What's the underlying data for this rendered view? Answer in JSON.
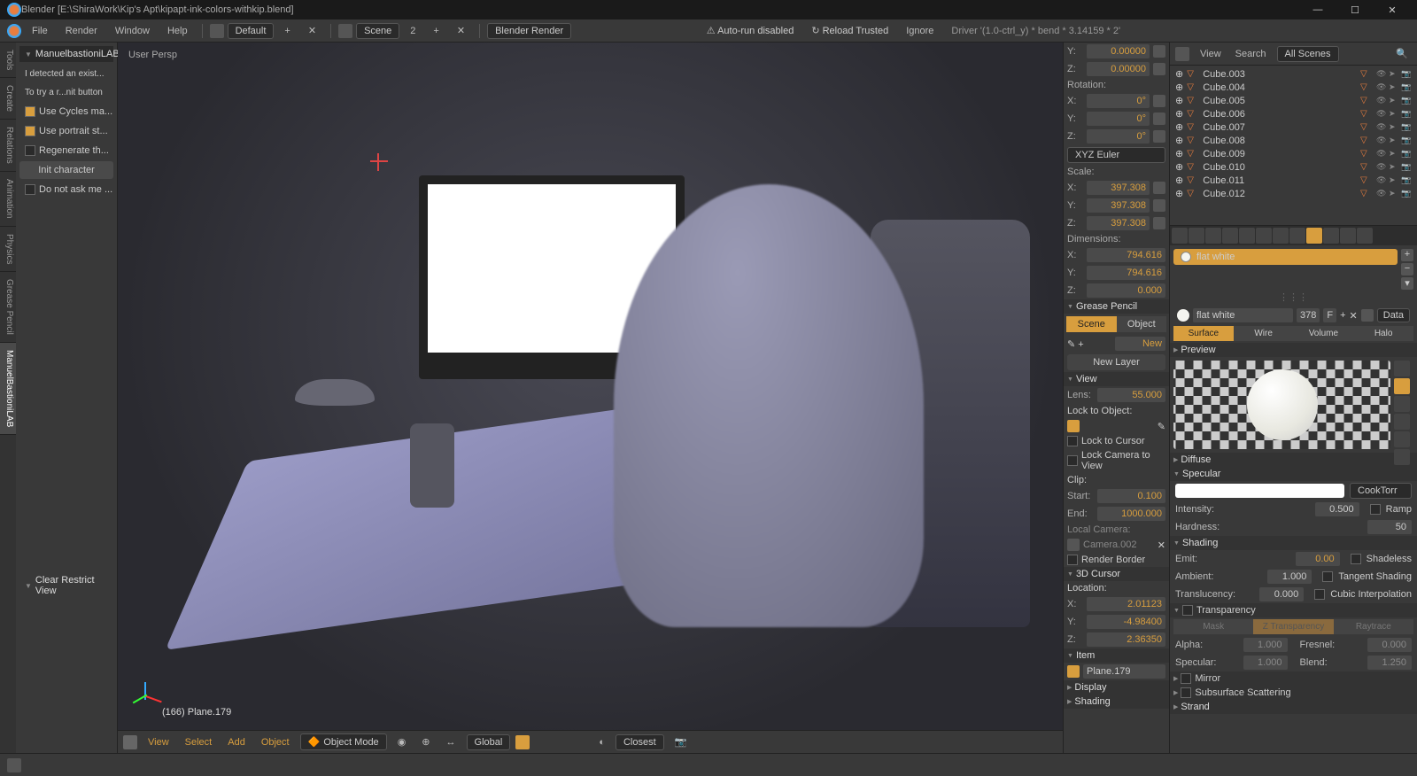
{
  "window": {
    "title": "Blender [E:\\ShiraWork\\Kip's Apt\\kipapt-ink-colors-withkip.blend]",
    "min": "—",
    "max": "☐",
    "close": "✕"
  },
  "topmenu": {
    "file": "File",
    "render": "Render",
    "window": "Window",
    "help": "Help",
    "layout": "Default",
    "plus1": "+",
    "x1": "✕",
    "scene": "Scene",
    "count": "2",
    "plus2": "+",
    "x2": "✕",
    "engine": "Blender Render",
    "autorun": "Auto-run disabled",
    "reload": "Reload Trusted",
    "ignore": "Ignore",
    "driver": "Driver '(1.0-ctrl_y) * bend * 3.14159 * 2'"
  },
  "tooltabs": [
    "Tools",
    "Create",
    "Relations",
    "Animation",
    "Physics",
    "Grease Pencil",
    "ManuelBastioniLAB"
  ],
  "toolpanel": {
    "header": "ManuelbastioniLAB",
    "info1": "I detected an exist...",
    "info2": "To try a r...nit button",
    "chk1": "Use Cycles ma...",
    "chk2": "Use portrait st...",
    "chk3": "Regenerate th...",
    "btn1": "Init character",
    "chk4": "Do not ask me ...",
    "restrict": "Clear Restrict View"
  },
  "viewport": {
    "persp": "User Persp",
    "objinfo": "(166) Plane.179"
  },
  "header3d": {
    "view": "View",
    "select": "Select",
    "add": "Add",
    "object": "Object",
    "mode": "Object Mode",
    "global": "Global",
    "closest": "Closest"
  },
  "npanel": {
    "y1": "Y:",
    "y1v": "0.00000",
    "z1": "Z:",
    "z1v": "0.00000",
    "rotation": "Rotation:",
    "rx": "X:",
    "rxv": "0°",
    "ry": "Y:",
    "ryv": "0°",
    "rz": "Z:",
    "rzv": "0°",
    "euler": "XYZ Euler",
    "scale": "Scale:",
    "sx": "X:",
    "sxv": "397.308",
    "sy": "Y:",
    "syv": "397.308",
    "sz": "Z:",
    "szv": "397.308",
    "dims": "Dimensions:",
    "dx": "X:",
    "dxv": "794.616",
    "dy": "Y:",
    "dyv": "794.616",
    "dz": "Z:",
    "dzv": "0.000",
    "gp": "Grease Pencil",
    "gpscene": "Scene",
    "gpobj": "Object",
    "gpnew": "New",
    "gpnewlayer": "New Layer",
    "view": "View",
    "lens": "Lens:",
    "lensv": "55.000",
    "lockobj": "Lock to Object:",
    "lockcursor": "Lock to Cursor",
    "lockcam": "Lock Camera to View",
    "clip": "Clip:",
    "start": "Start:",
    "startv": "0.100",
    "end": "End:",
    "endv": "1000.000",
    "localcam": "Local Camera:",
    "cam": "Camera.002",
    "renderborder": "Render Border",
    "cursor3d": "3D Cursor",
    "loc": "Location:",
    "lx": "X:",
    "lxv": "2.01123",
    "ly": "Y:",
    "lyv": "-4.98400",
    "lz": "Z:",
    "lzv": "2.36350",
    "item": "Item",
    "itemname": "Plane.179",
    "display": "Display",
    "shading": "Shading"
  },
  "outliner": {
    "view": "View",
    "search": "Search",
    "allscenes": "All Scenes",
    "items": [
      "Cube.003",
      "Cube.004",
      "Cube.005",
      "Cube.006",
      "Cube.007",
      "Cube.008",
      "Cube.009",
      "Cube.010",
      "Cube.011",
      "Cube.012"
    ]
  },
  "props": {
    "matname": "flat white",
    "matusers": "378",
    "f": "F",
    "data": "Data",
    "tabs": {
      "surface": "Surface",
      "wire": "Wire",
      "volume": "Volume",
      "halo": "Halo"
    },
    "preview": "Preview",
    "diffuse": "Diffuse",
    "specular": "Specular",
    "cooktorr": "CookTorr",
    "intensity": "Intensity:",
    "intv": "0.500",
    "ramp": "Ramp",
    "hardness": "Hardness:",
    "hardv": "50",
    "shading": "Shading",
    "emit": "Emit:",
    "emitv": "0.00",
    "shadeless": "Shadeless",
    "ambient": "Ambient:",
    "ambv": "1.000",
    "tangent": "Tangent Shading",
    "translucency": "Translucency:",
    "transv": "0.000",
    "cubic": "Cubic Interpolation",
    "transparency": "Transparency",
    "mask": "Mask",
    "ztrans": "Z Transparency",
    "raytrace": "Raytrace",
    "alpha": "Alpha:",
    "alphav": "1.000",
    "fresnel": "Fresnel:",
    "fresv": "0.000",
    "specalpha": "Specular:",
    "specv": "1.000",
    "blend": "Blend:",
    "blendv": "1.250",
    "mirror": "Mirror",
    "sss": "Subsurface Scattering",
    "strand": "Strand"
  }
}
